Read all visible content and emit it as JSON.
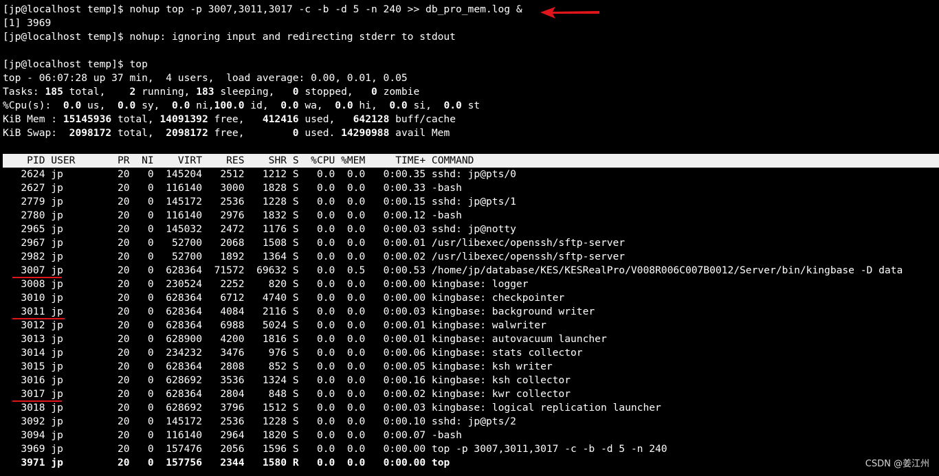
{
  "terminal": {
    "cmd_line": "[jp@localhost temp]$ nohup top -p 3007,3011,3017 -c -b -d 5 -n 240 >> db_pro_mem.log &",
    "job_line": "[1] 3969",
    "nohup_line": "[jp@localhost temp]$ nohup: ignoring input and redirecting stderr to stdout",
    "blank_line": "",
    "top_cmd_line": "[jp@localhost temp]$ top",
    "summary": {
      "uptime_line": "top - 06:07:28 up 37 min,  4 users,  load average: 0.00, 0.01, 0.05",
      "tasks": {
        "label": "Tasks: ",
        "total": "185",
        "total_lbl": " total,    ",
        "running": "2",
        "running_lbl": " running, ",
        "sleeping": "183",
        "sleeping_lbl": " sleeping,   ",
        "stopped": "0",
        "stopped_lbl": " stopped,   ",
        "zombie": "0",
        "zombie_lbl": " zombie"
      },
      "cpu": {
        "label": "%Cpu(s):  ",
        "us": "0.0",
        "us_lbl": " us,  ",
        "sy": "0.0",
        "sy_lbl": " sy,  ",
        "ni": "0.0",
        "ni_lbl": " ni,",
        "id": "100.0",
        "id_lbl": " id,  ",
        "wa": "0.0",
        "wa_lbl": " wa,  ",
        "hi": "0.0",
        "hi_lbl": " hi,  ",
        "si": "0.0",
        "si_lbl": " si,  ",
        "st": "0.0",
        "st_lbl": " st"
      },
      "mem": {
        "label": "KiB Mem : ",
        "total": "15145936",
        "total_lbl": " total, ",
        "free": "14091392",
        "free_lbl": " free,   ",
        "used": "412416",
        "used_lbl": " used,   ",
        "buff": "642128",
        "buff_lbl": " buff/cache"
      },
      "swap": {
        "label": "KiB Swap:  ",
        "total": "2098172",
        "total_lbl": " total,  ",
        "free": "2098172",
        "free_lbl": " free,        ",
        "used": "0",
        "used_lbl": " used. ",
        "avail": "14290988",
        "avail_lbl": " avail Mem"
      }
    },
    "columns": {
      "pid": "PID",
      "user": "USER",
      "pr": "PR",
      "ni": "NI",
      "virt": "VIRT",
      "res": "RES",
      "shr": "SHR",
      "s": "S",
      "cpu": "%CPU",
      "mem": "%MEM",
      "time": "TIME+",
      "command": "COMMAND"
    },
    "processes": [
      {
        "pid": "2624",
        "user": "jp",
        "pr": "20",
        "ni": "0",
        "virt": "145204",
        "res": "2512",
        "shr": "1212",
        "s": "S",
        "cpu": "0.0",
        "mem": "0.0",
        "time": "0:00.35",
        "command": "sshd: jp@pts/0"
      },
      {
        "pid": "2627",
        "user": "jp",
        "pr": "20",
        "ni": "0",
        "virt": "116140",
        "res": "3000",
        "shr": "1828",
        "s": "S",
        "cpu": "0.0",
        "mem": "0.0",
        "time": "0:00.33",
        "command": "-bash"
      },
      {
        "pid": "2779",
        "user": "jp",
        "pr": "20",
        "ni": "0",
        "virt": "145172",
        "res": "2536",
        "shr": "1228",
        "s": "S",
        "cpu": "0.0",
        "mem": "0.0",
        "time": "0:00.15",
        "command": "sshd: jp@pts/1"
      },
      {
        "pid": "2780",
        "user": "jp",
        "pr": "20",
        "ni": "0",
        "virt": "116140",
        "res": "2976",
        "shr": "1832",
        "s": "S",
        "cpu": "0.0",
        "mem": "0.0",
        "time": "0:00.12",
        "command": "-bash"
      },
      {
        "pid": "2965",
        "user": "jp",
        "pr": "20",
        "ni": "0",
        "virt": "145032",
        "res": "2472",
        "shr": "1176",
        "s": "S",
        "cpu": "0.0",
        "mem": "0.0",
        "time": "0:00.03",
        "command": "sshd: jp@notty"
      },
      {
        "pid": "2967",
        "user": "jp",
        "pr": "20",
        "ni": "0",
        "virt": "52700",
        "res": "2068",
        "shr": "1508",
        "s": "S",
        "cpu": "0.0",
        "mem": "0.0",
        "time": "0:00.01",
        "command": "/usr/libexec/openssh/sftp-server"
      },
      {
        "pid": "2982",
        "user": "jp",
        "pr": "20",
        "ni": "0",
        "virt": "52700",
        "res": "1892",
        "shr": "1364",
        "s": "S",
        "cpu": "0.0",
        "mem": "0.0",
        "time": "0:00.02",
        "command": "/usr/libexec/openssh/sftp-server"
      },
      {
        "pid": "3007",
        "user": "jp",
        "pr": "20",
        "ni": "0",
        "virt": "628364",
        "res": "71572",
        "shr": "69632",
        "s": "S",
        "cpu": "0.0",
        "mem": "0.5",
        "time": "0:00.53",
        "command": "/home/jp/database/KES/KESRealPro/V008R006C007B0012/Server/bin/kingbase -D data"
      },
      {
        "pid": "3008",
        "user": "jp",
        "pr": "20",
        "ni": "0",
        "virt": "230524",
        "res": "2252",
        "shr": "820",
        "s": "S",
        "cpu": "0.0",
        "mem": "0.0",
        "time": "0:00.00",
        "command": "kingbase: logger"
      },
      {
        "pid": "3010",
        "user": "jp",
        "pr": "20",
        "ni": "0",
        "virt": "628364",
        "res": "6712",
        "shr": "4740",
        "s": "S",
        "cpu": "0.0",
        "mem": "0.0",
        "time": "0:00.00",
        "command": "kingbase: checkpointer"
      },
      {
        "pid": "3011",
        "user": "jp",
        "pr": "20",
        "ni": "0",
        "virt": "628364",
        "res": "4084",
        "shr": "2116",
        "s": "S",
        "cpu": "0.0",
        "mem": "0.0",
        "time": "0:00.03",
        "command": "kingbase: background writer"
      },
      {
        "pid": "3012",
        "user": "jp",
        "pr": "20",
        "ni": "0",
        "virt": "628364",
        "res": "6988",
        "shr": "5024",
        "s": "S",
        "cpu": "0.0",
        "mem": "0.0",
        "time": "0:00.01",
        "command": "kingbase: walwriter"
      },
      {
        "pid": "3013",
        "user": "jp",
        "pr": "20",
        "ni": "0",
        "virt": "628900",
        "res": "4200",
        "shr": "1816",
        "s": "S",
        "cpu": "0.0",
        "mem": "0.0",
        "time": "0:00.01",
        "command": "kingbase: autovacuum launcher"
      },
      {
        "pid": "3014",
        "user": "jp",
        "pr": "20",
        "ni": "0",
        "virt": "234232",
        "res": "3476",
        "shr": "976",
        "s": "S",
        "cpu": "0.0",
        "mem": "0.0",
        "time": "0:00.06",
        "command": "kingbase: stats collector"
      },
      {
        "pid": "3015",
        "user": "jp",
        "pr": "20",
        "ni": "0",
        "virt": "628364",
        "res": "2808",
        "shr": "852",
        "s": "S",
        "cpu": "0.0",
        "mem": "0.0",
        "time": "0:00.05",
        "command": "kingbase: ksh writer"
      },
      {
        "pid": "3016",
        "user": "jp",
        "pr": "20",
        "ni": "0",
        "virt": "628692",
        "res": "3536",
        "shr": "1324",
        "s": "S",
        "cpu": "0.0",
        "mem": "0.0",
        "time": "0:00.16",
        "command": "kingbase: ksh collector"
      },
      {
        "pid": "3017",
        "user": "jp",
        "pr": "20",
        "ni": "0",
        "virt": "628364",
        "res": "2804",
        "shr": "848",
        "s": "S",
        "cpu": "0.0",
        "mem": "0.0",
        "time": "0:00.02",
        "command": "kingbase: kwr collector"
      },
      {
        "pid": "3018",
        "user": "jp",
        "pr": "20",
        "ni": "0",
        "virt": "628692",
        "res": "3796",
        "shr": "1512",
        "s": "S",
        "cpu": "0.0",
        "mem": "0.0",
        "time": "0:00.03",
        "command": "kingbase: logical replication launcher"
      },
      {
        "pid": "3092",
        "user": "jp",
        "pr": "20",
        "ni": "0",
        "virt": "145172",
        "res": "2536",
        "shr": "1228",
        "s": "S",
        "cpu": "0.0",
        "mem": "0.0",
        "time": "0:00.10",
        "command": "sshd: jp@pts/2"
      },
      {
        "pid": "3094",
        "user": "jp",
        "pr": "20",
        "ni": "0",
        "virt": "116140",
        "res": "2964",
        "shr": "1820",
        "s": "S",
        "cpu": "0.0",
        "mem": "0.0",
        "time": "0:00.07",
        "command": "-bash"
      },
      {
        "pid": "3969",
        "user": "jp",
        "pr": "20",
        "ni": "0",
        "virt": "157476",
        "res": "2056",
        "shr": "1596",
        "s": "S",
        "cpu": "0.0",
        "mem": "0.0",
        "time": "0:00.00",
        "command": "top -p 3007,3011,3017 -c -b -d 5 -n 240"
      },
      {
        "pid": "3971",
        "user": "jp",
        "pr": "20",
        "ni": "0",
        "virt": "157756",
        "res": "2344",
        "shr": "1580",
        "s": "R",
        "cpu": "0.0",
        "mem": "0.0",
        "time": "0:00.00",
        "command": "top",
        "bold": true
      }
    ]
  },
  "watermark": "CSDN @姜江州",
  "colors": {
    "background": "#000000",
    "text": "#ffffff",
    "header_bar": "#f0f0f0",
    "annotation_red": "#e0151b"
  }
}
